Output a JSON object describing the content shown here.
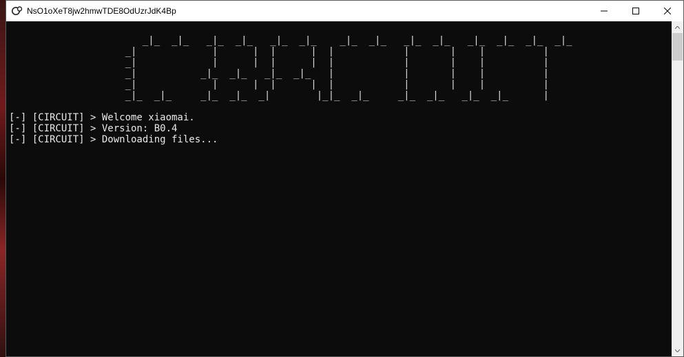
{
  "window": {
    "title": "NsO1oXeT8jw2hmwTDE8OdUzrJdK4Bp"
  },
  "console": {
    "ascii_art": "                       _|_  _|_   _|_  _|_   _|_  _|_    _|_  _|_   _|_  _|_   _|_  _|_  _|_  _|_\n                    _|             |      |  |      |  |            |       |    |          |\n                    _|             |      |  |      |  |            |       |    |          |\n                    _|           _|_  _|_   _|_  _|_   |            |       |    |          |\n                    _|             |      |  |      |  |            |       |    |          |\n                    _|_  _|_     _|_  _|_  _|        |_|_  _|_     _|_  _|_   _|_  _|_      |",
    "lines": [
      {
        "prefix": "[-] [CIRCUIT] > ",
        "text": "Welcome xiaomai."
      },
      {
        "prefix": "[-] [CIRCUIT] > ",
        "text": "Version: B0.4"
      },
      {
        "prefix": "[-] [CIRCUIT] > ",
        "text": "Downloading files..."
      }
    ]
  }
}
